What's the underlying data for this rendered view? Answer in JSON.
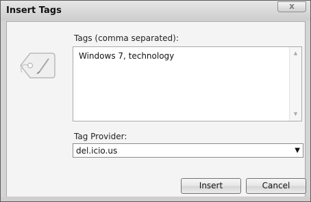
{
  "window": {
    "title": "Insert Tags",
    "close_glyph": "x"
  },
  "tags": {
    "label": "Tags (comma separated):",
    "value": "Windows 7, technology"
  },
  "provider": {
    "label": "Tag Provider:",
    "selected": "del.icio.us"
  },
  "buttons": {
    "insert": "Insert",
    "cancel": "Cancel"
  },
  "icons": {
    "tag": "tag-icon",
    "scroll_up": "scroll-up-arrow-icon",
    "scroll_down": "scroll-down-arrow-icon",
    "dropdown": "chevron-down-icon"
  }
}
